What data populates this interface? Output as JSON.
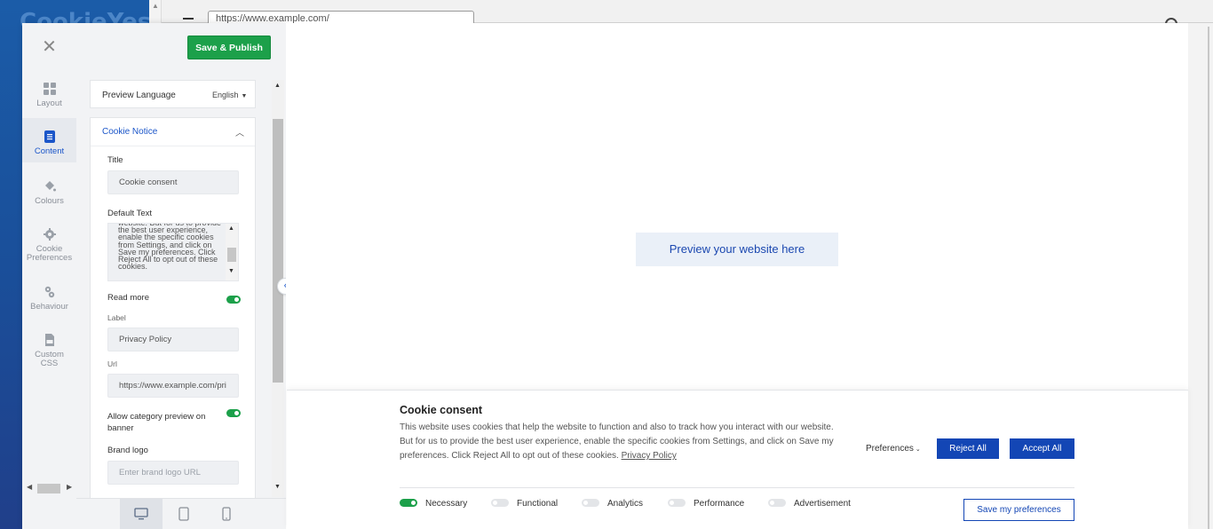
{
  "browser": {
    "address_text": "https://www.example.com/",
    "logo_text": "CookieYes"
  },
  "toolbar": {
    "publish_label": "Save & Publish"
  },
  "rail": {
    "items": [
      {
        "label": "Layout",
        "icon": "layout-icon"
      },
      {
        "label": "Content",
        "icon": "content-icon",
        "active": true
      },
      {
        "label": "Colours",
        "icon": "paint-bucket-icon"
      },
      {
        "label": "Cookie Preferences",
        "icon": "gear-icon"
      },
      {
        "label": "Behaviour",
        "icon": "behaviour-icon"
      },
      {
        "label": "Custom CSS",
        "icon": "css-file-icon"
      }
    ]
  },
  "language": {
    "label": "Preview Language",
    "value": "English"
  },
  "cookie_notice": {
    "section_title": "Cookie Notice",
    "title_label": "Title",
    "title_value": "Cookie consent",
    "default_text_label": "Default Text",
    "default_text_value": "website. But for us to provide the best user experience, enable the specific cookies from Settings, and click on Save my preferences. Click Reject All to opt out of these cookies.",
    "read_more_label": "Read more",
    "read_more_on": true,
    "label_label": "Label",
    "label_value": "Privacy Policy",
    "url_label": "Url",
    "url_value": "https://www.example.com/pri",
    "category_preview_label": "Allow category preview on banner",
    "category_preview_on": true,
    "brand_logo_label": "Brand logo",
    "brand_logo_placeholder": "Enter brand logo URL"
  },
  "preview": {
    "placeholder_label": "Preview your website here"
  },
  "banner": {
    "title": "Cookie consent",
    "text": "This website uses cookies that help the website to function and also to track how you interact with our website. But for us to provide the best user experience, enable the specific cookies from Settings, and click on Save my preferences. Click Reject All to opt out of these cookies.",
    "link_text": "Privacy Policy",
    "preferences_label": "Preferences",
    "reject_label": "Reject All",
    "accept_label": "Accept All",
    "save_label": "Save my preferences",
    "categories": [
      {
        "name": "Necessary",
        "enabled": true
      },
      {
        "name": "Functional",
        "enabled": false
      },
      {
        "name": "Analytics",
        "enabled": false
      },
      {
        "name": "Performance",
        "enabled": false
      },
      {
        "name": "Advertisement",
        "enabled": false
      }
    ]
  },
  "colors": {
    "publish_green": "#1ca04a",
    "accent_blue": "#1346b5",
    "link_blue": "#1b56c9"
  }
}
